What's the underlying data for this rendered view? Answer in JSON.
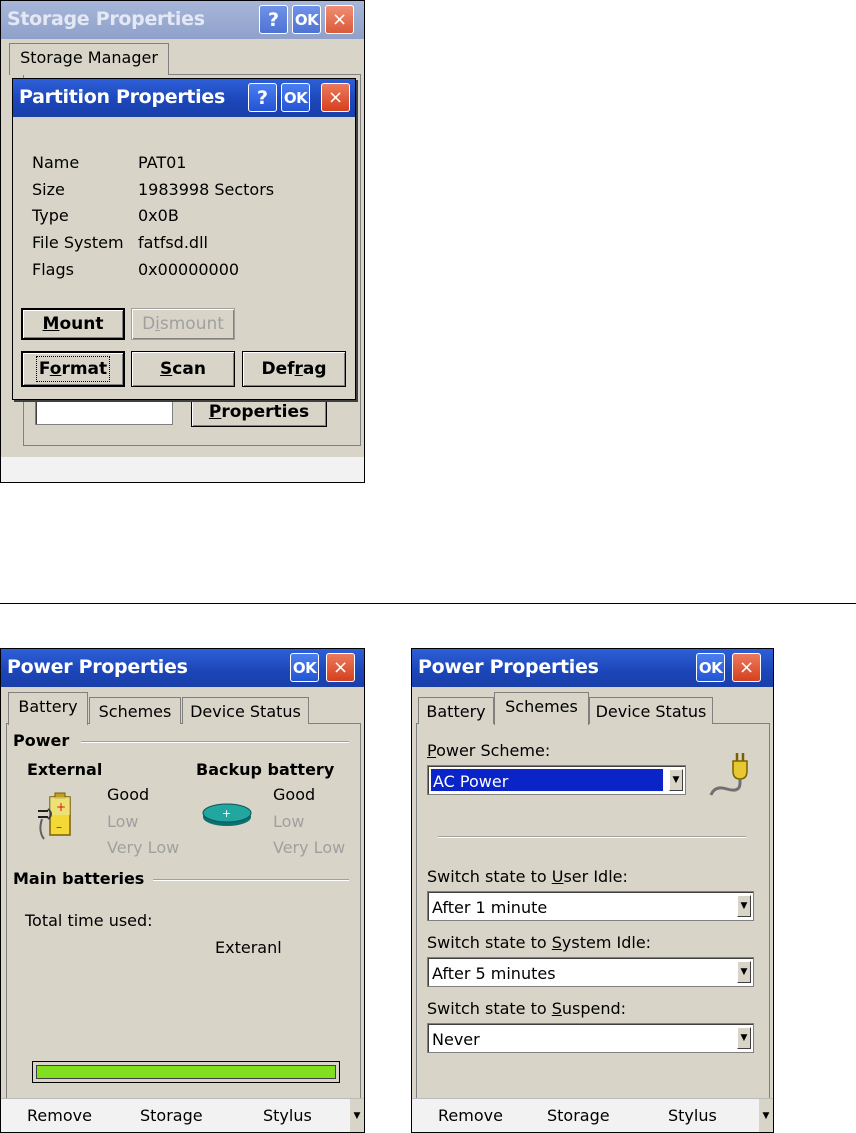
{
  "storage": {
    "title": "Storage Properties",
    "tab": "Storage Manager",
    "properties_button": "Properties",
    "help_label": "?",
    "ok_label": "OK",
    "close_label": "×"
  },
  "partition": {
    "title": "Partition Properties",
    "help_label": "?",
    "ok_label": "OK",
    "close_label": "×",
    "fields": [
      {
        "label": "Name",
        "value": "PAT01"
      },
      {
        "label": "Size",
        "value": "1983998 Sectors"
      },
      {
        "label": "Type",
        "value": "0x0B"
      },
      {
        "label": "File System",
        "value": "fatfsd.dll"
      },
      {
        "label": "Flags",
        "value": "0x00000000"
      }
    ],
    "buttons": {
      "mount": {
        "a": "",
        "u": "M",
        "b": "ount"
      },
      "dismount": {
        "a": "D",
        "u": "i",
        "b": "smount"
      },
      "format": {
        "a": "F",
        "u": "o",
        "b": "rmat"
      },
      "scan": {
        "a": "",
        "u": "S",
        "b": "can"
      },
      "defrag": {
        "a": "Def",
        "u": "r",
        "b": "ag"
      }
    }
  },
  "power_battery": {
    "title": "Power Properties",
    "ok_label": "OK",
    "close_label": "×",
    "tabs": [
      "Battery",
      "Schemes",
      "Device Status"
    ],
    "power_group": "Power",
    "external_label": "External",
    "backup_label": "Backup battery",
    "levels": [
      "Good",
      "Low",
      "Very Low"
    ],
    "main_group": "Main batteries",
    "total_time_label": "Total time used:",
    "source_value": "Exteranl",
    "charge_fraction": 1.0,
    "charge_color": "#80e020"
  },
  "power_schemes": {
    "title": "Power Properties",
    "ok_label": "OK",
    "close_label": "×",
    "tabs": [
      "Battery",
      "Schemes",
      "Device Status"
    ],
    "scheme_label": {
      "u": "P",
      "b": "ower Scheme:"
    },
    "scheme_value": "AC Power",
    "user_idle_label": {
      "a": "Switch state to ",
      "u": "U",
      "b": "ser Idle:"
    },
    "user_idle_value": "After 1 minute",
    "system_idle_label": {
      "a": "Switch state to ",
      "u": "S",
      "b": "ystem Idle:"
    },
    "system_idle_value": "After 5 minutes",
    "suspend_label": {
      "a": "Switch state to ",
      "u": "S",
      "b": "uspend:"
    },
    "suspend_value": "Never"
  },
  "menubar": {
    "items": [
      "Remove",
      "Storage",
      "Stylus"
    ]
  },
  "icons": {
    "battery": "battery-plug-icon",
    "coin_cell": "coin-battery-icon",
    "plug": "power-plug-icon"
  }
}
